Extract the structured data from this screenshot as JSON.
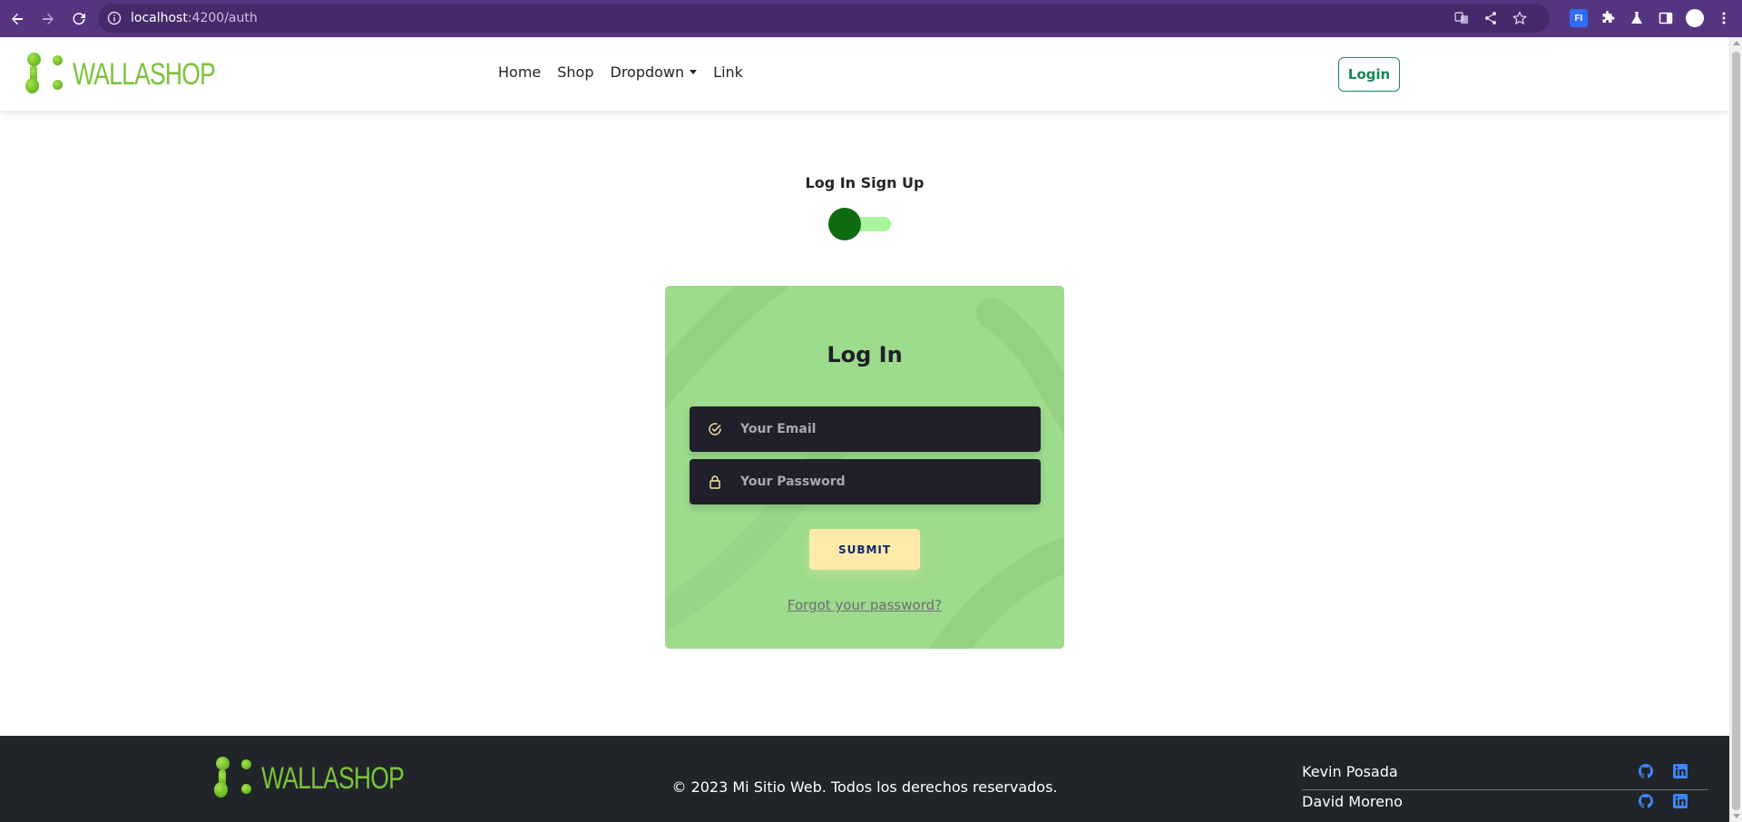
{
  "browser": {
    "url_host": "localhost",
    "url_path": ":4200/auth",
    "extension_label": "FI"
  },
  "navbar": {
    "logo_text": "WALLASHOP",
    "links": [
      "Home",
      "Shop",
      "Dropdown",
      "Link"
    ],
    "login_label": "Login"
  },
  "toggle": {
    "label": "Log In Sign Up",
    "state": "log-in"
  },
  "auth_card": {
    "title": "Log In",
    "email_placeholder": "Your Email",
    "password_placeholder": "Your Password",
    "submit_label": "SUBMIT",
    "forgot_label": "Forgot your password?"
  },
  "footer": {
    "logo_text": "WALLASHOP",
    "copyright": "© 2023 Mi Sitio Web. Todos los derechos reservados.",
    "authors": [
      {
        "name": "Kevin Posada"
      },
      {
        "name": "David Moreno"
      }
    ]
  },
  "colors": {
    "browser_chrome": "#55357f",
    "brand_green": "#7cc23a",
    "login_button": "#198754",
    "card_background": "#9ddb8d",
    "field_background": "#1f2029",
    "submit_background": "#ffeba7",
    "footer_background": "#212529",
    "social_icon": "#3b86f7"
  },
  "icons": {
    "email_field": "check-circle-icon",
    "password_field": "lock-icon",
    "author_links": [
      "github-icon",
      "linkedin-icon"
    ]
  }
}
